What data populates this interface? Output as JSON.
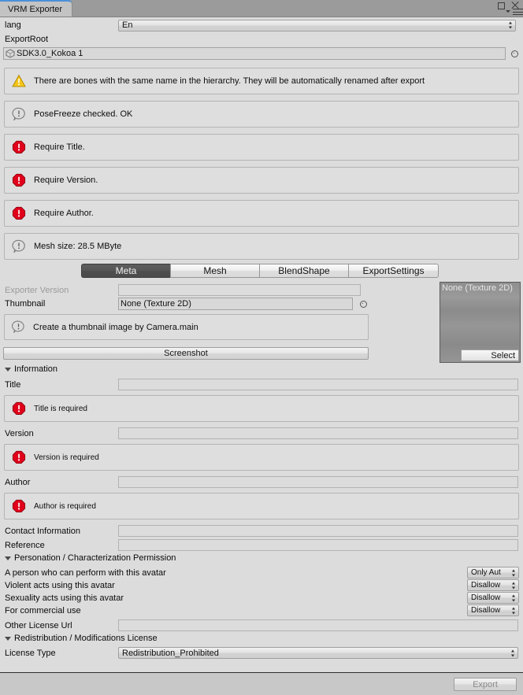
{
  "window": {
    "tab_title": "VRM Exporter",
    "controls": {
      "maximize": "maximize-icon",
      "close": "close-icon",
      "options": "options-menu-icon"
    }
  },
  "top": {
    "lang_label": "lang",
    "lang_value": "En",
    "export_root_label": "ExportRoot",
    "export_root_value": "SDK3.0_Kokoa 1"
  },
  "messages": [
    {
      "type": "warning",
      "text": "There are bones with the same name in the hierarchy. They will be automatically renamed after export"
    },
    {
      "type": "info",
      "text": "PoseFreeze checked. OK"
    },
    {
      "type": "error",
      "text": "Require Title."
    },
    {
      "type": "error",
      "text": "Require Version."
    },
    {
      "type": "error",
      "text": "Require Author."
    },
    {
      "type": "info",
      "text": "Mesh size: 28.5 MByte"
    }
  ],
  "tabs": [
    {
      "label": "Meta",
      "active": true
    },
    {
      "label": "Mesh",
      "active": false
    },
    {
      "label": "BlendShape",
      "active": false
    },
    {
      "label": "ExportSettings",
      "active": false
    }
  ],
  "meta": {
    "exporter_version_label": "Exporter Version",
    "exporter_version_value": "",
    "thumbnail_label": "Thumbnail",
    "thumbnail_value": "None (Texture 2D)",
    "thumbnail_hint": "Create a thumbnail image by Camera.main",
    "screenshot_button": "Screenshot",
    "preview_caption": "None (Texture 2D)",
    "preview_select_button": "Select"
  },
  "information": {
    "section_label": "Information",
    "fields": [
      {
        "label": "Title",
        "value": "",
        "error": "Title is required"
      },
      {
        "label": "Version",
        "value": "",
        "error": "Version is required"
      },
      {
        "label": "Author",
        "value": "",
        "error": "Author is required"
      },
      {
        "label": "Contact Information",
        "value": "",
        "error": null
      },
      {
        "label": "Reference",
        "value": "",
        "error": null
      }
    ]
  },
  "permission": {
    "section_label": "Personation / Characterization Permission",
    "rows": [
      {
        "label": "A person who can perform with this avatar",
        "value": "Only Aut"
      },
      {
        "label": "Violent acts using this avatar",
        "value": "Disallow"
      },
      {
        "label": "Sexuality acts using this avatar",
        "value": "Disallow"
      },
      {
        "label": "For commercial use",
        "value": "Disallow"
      }
    ],
    "other_license_url_label": "Other License Url",
    "other_license_url_value": ""
  },
  "redistribution": {
    "section_label": "Redistribution / Modifications License",
    "license_type_label": "License Type",
    "license_type_value": "Redistribution_Prohibited"
  },
  "footer": {
    "export_button": "Export",
    "export_enabled": false
  },
  "colors": {
    "window_bg": "#dcdcdc",
    "helpbox_bg": "#dedede",
    "titlebar_bg": "#9b9b9b",
    "tab_active_bg": "#545454",
    "error_red": "#e0001b",
    "warning_yellow": "#f5c518",
    "accent_blue": "#4a90d9",
    "footer_bg": "#c8c8c8"
  }
}
